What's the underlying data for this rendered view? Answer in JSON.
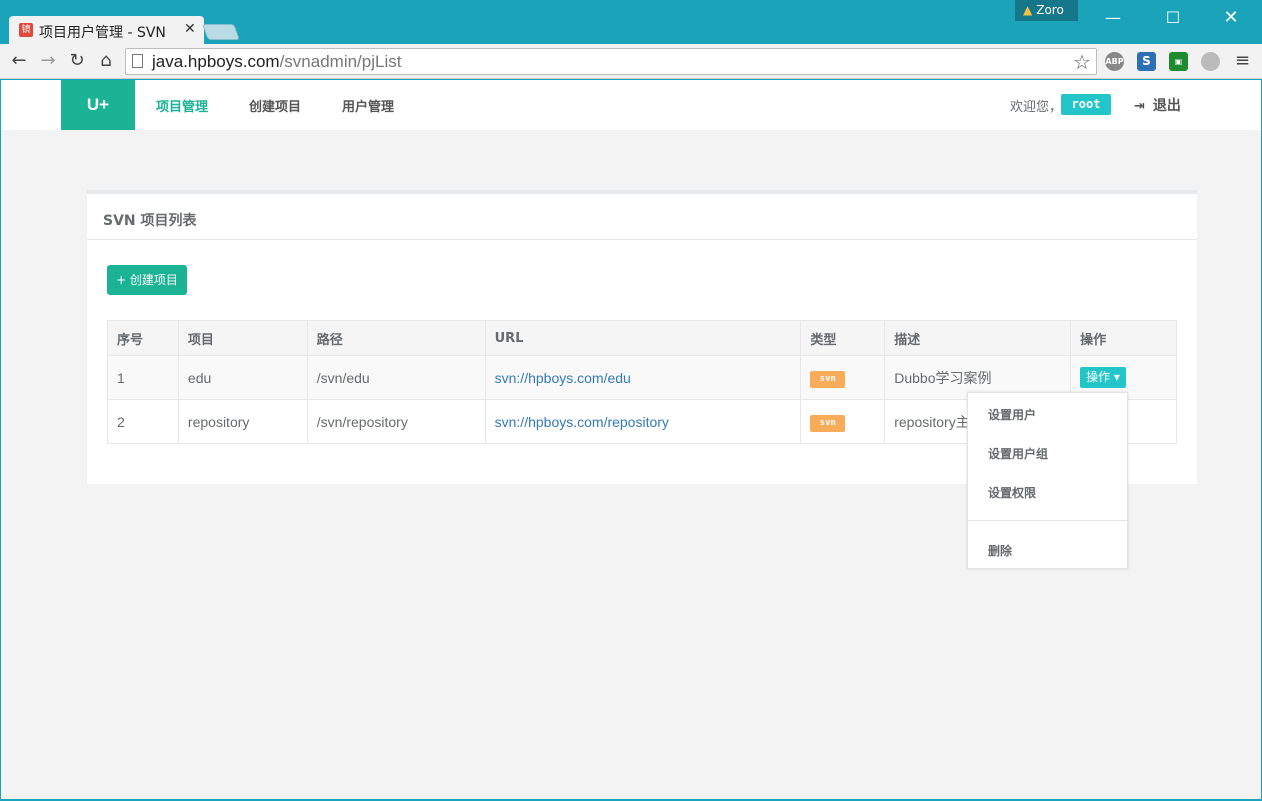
{
  "browser": {
    "tab_title": "项目用户管理 - SVN",
    "tab_favicon": "镜",
    "profile_name": "Zoro",
    "url_host": "java.hpboys.com",
    "url_path": "/svnadmin/pjList",
    "extensions": {
      "abp": "ABP",
      "s": "S"
    }
  },
  "navbar": {
    "brand": "U+",
    "links": [
      "项目管理",
      "创建项目",
      "用户管理"
    ],
    "welcome": "欢迎您，",
    "username": "root",
    "logout": "退出"
  },
  "panel": {
    "title": "SVN 项目列表",
    "create_button": "+ 创建项目"
  },
  "table": {
    "headers": [
      "序号",
      "项目",
      "路径",
      "URL",
      "类型",
      "描述",
      "操作"
    ],
    "rows": [
      {
        "index": "1",
        "project": "edu",
        "path": "/svn/edu",
        "url": "svn://hpboys.com/edu",
        "type": "svn",
        "description": "Dubbo学习案例",
        "action": "操作"
      },
      {
        "index": "2",
        "project": "repository",
        "path": "/svn/repository",
        "url": "svn://hpboys.com/repository",
        "type": "svn",
        "description": "repository主",
        "action": ""
      }
    ]
  },
  "dropdown": {
    "items": [
      "设置用户",
      "设置用户组",
      "设置权限",
      "删除"
    ]
  },
  "colors": {
    "primary": "#1ab394",
    "info": "#23c6c8",
    "warning": "#f8ac59",
    "chrome": "#1aa3b9"
  }
}
